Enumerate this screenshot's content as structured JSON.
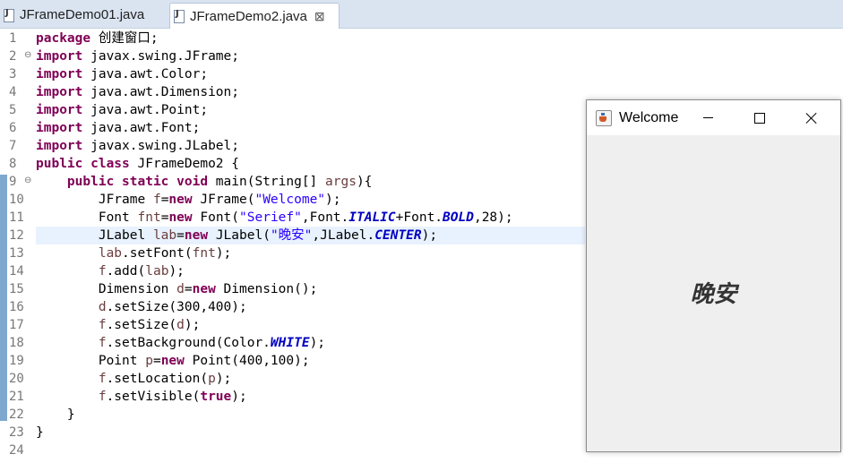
{
  "tabs": [
    {
      "label": "JFrameDemo01.java",
      "active": false
    },
    {
      "label": "JFrameDemo2.java",
      "active": true,
      "close": "⊠"
    }
  ],
  "editor": {
    "highlighted_line": 12,
    "lines": [
      {
        "n": "1",
        "fold": "",
        "tokens": [
          [
            "kw",
            "package"
          ],
          [
            "t",
            " 创建窗口;"
          ]
        ]
      },
      {
        "n": "2",
        "fold": "⊖",
        "tokens": [
          [
            "kw",
            "import"
          ],
          [
            "t",
            " javax.swing.JFrame;"
          ]
        ]
      },
      {
        "n": "3",
        "fold": "",
        "tokens": [
          [
            "kw",
            "import"
          ],
          [
            "t",
            " java.awt.Color;"
          ]
        ]
      },
      {
        "n": "4",
        "fold": "",
        "tokens": [
          [
            "kw",
            "import"
          ],
          [
            "t",
            " java.awt.Dimension;"
          ]
        ]
      },
      {
        "n": "5",
        "fold": "",
        "tokens": [
          [
            "kw",
            "import"
          ],
          [
            "t",
            " java.awt.Point;"
          ]
        ]
      },
      {
        "n": "6",
        "fold": "",
        "tokens": [
          [
            "kw",
            "import"
          ],
          [
            "t",
            " java.awt.Font;"
          ]
        ]
      },
      {
        "n": "7",
        "fold": "",
        "tokens": [
          [
            "kw",
            "import"
          ],
          [
            "t",
            " javax.swing.JLabel;"
          ]
        ]
      },
      {
        "n": "8",
        "fold": "",
        "tokens": [
          [
            "kw",
            "public class"
          ],
          [
            "t",
            " JFrameDemo2 {"
          ]
        ]
      },
      {
        "n": "9",
        "fold": "⊖",
        "tokens": [
          [
            "t",
            "    "
          ],
          [
            "kw",
            "public static void"
          ],
          [
            "t",
            " main(String[] "
          ],
          [
            "var",
            "args"
          ],
          [
            "t",
            "){"
          ]
        ]
      },
      {
        "n": "10",
        "fold": "",
        "tokens": [
          [
            "t",
            "        JFrame "
          ],
          [
            "var",
            "f"
          ],
          [
            "t",
            "="
          ],
          [
            "kw",
            "new"
          ],
          [
            "t",
            " JFrame("
          ],
          [
            "str",
            "\"Welcome\""
          ],
          [
            "t",
            ");"
          ]
        ]
      },
      {
        "n": "11",
        "fold": "",
        "tokens": [
          [
            "t",
            "        Font "
          ],
          [
            "var",
            "fnt"
          ],
          [
            "t",
            "="
          ],
          [
            "kw",
            "new"
          ],
          [
            "t",
            " Font("
          ],
          [
            "str",
            "\"Serief\""
          ],
          [
            "t",
            ",Font."
          ],
          [
            "cst",
            "ITALIC"
          ],
          [
            "t",
            "+Font."
          ],
          [
            "cst",
            "BOLD"
          ],
          [
            "t",
            ",28);"
          ]
        ]
      },
      {
        "n": "12",
        "fold": "",
        "tokens": [
          [
            "t",
            "        JLabel "
          ],
          [
            "var",
            "lab"
          ],
          [
            "t",
            "="
          ],
          [
            "kw",
            "new"
          ],
          [
            "t",
            " JLabel("
          ],
          [
            "str",
            "\"晚安\""
          ],
          [
            "t",
            ",JLabel."
          ],
          [
            "cst",
            "CENTER"
          ],
          [
            "t",
            ");"
          ]
        ]
      },
      {
        "n": "13",
        "fold": "",
        "tokens": [
          [
            "t",
            "        "
          ],
          [
            "var",
            "lab"
          ],
          [
            "t",
            ".setFont("
          ],
          [
            "var",
            "fnt"
          ],
          [
            "t",
            ");"
          ]
        ]
      },
      {
        "n": "14",
        "fold": "",
        "tokens": [
          [
            "t",
            "        "
          ],
          [
            "var",
            "f"
          ],
          [
            "t",
            ".add("
          ],
          [
            "var",
            "lab"
          ],
          [
            "t",
            ");"
          ]
        ]
      },
      {
        "n": "15",
        "fold": "",
        "tokens": [
          [
            "t",
            "        Dimension "
          ],
          [
            "var",
            "d"
          ],
          [
            "t",
            "="
          ],
          [
            "kw",
            "new"
          ],
          [
            "t",
            " Dimension();"
          ]
        ]
      },
      {
        "n": "16",
        "fold": "",
        "tokens": [
          [
            "t",
            "        "
          ],
          [
            "var",
            "d"
          ],
          [
            "t",
            ".setSize(300,400);"
          ]
        ]
      },
      {
        "n": "17",
        "fold": "",
        "tokens": [
          [
            "t",
            "        "
          ],
          [
            "var",
            "f"
          ],
          [
            "t",
            ".setSize("
          ],
          [
            "var",
            "d"
          ],
          [
            "t",
            ");"
          ]
        ]
      },
      {
        "n": "18",
        "fold": "",
        "tokens": [
          [
            "t",
            "        "
          ],
          [
            "var",
            "f"
          ],
          [
            "t",
            ".setBackground(Color."
          ],
          [
            "cst",
            "WHITE"
          ],
          [
            "t",
            ");"
          ]
        ]
      },
      {
        "n": "19",
        "fold": "",
        "tokens": [
          [
            "t",
            "        Point "
          ],
          [
            "var",
            "p"
          ],
          [
            "t",
            "="
          ],
          [
            "kw",
            "new"
          ],
          [
            "t",
            " Point(400,100);"
          ]
        ]
      },
      {
        "n": "20",
        "fold": "",
        "tokens": [
          [
            "t",
            "        "
          ],
          [
            "var",
            "f"
          ],
          [
            "t",
            ".setLocation("
          ],
          [
            "var",
            "p"
          ],
          [
            "t",
            ");"
          ]
        ]
      },
      {
        "n": "21",
        "fold": "",
        "tokens": [
          [
            "t",
            "        "
          ],
          [
            "var",
            "f"
          ],
          [
            "t",
            ".setVisible("
          ],
          [
            "kw",
            "true"
          ],
          [
            "t",
            ");"
          ]
        ]
      },
      {
        "n": "22",
        "fold": "",
        "tokens": [
          [
            "t",
            "    }"
          ]
        ]
      },
      {
        "n": "23",
        "fold": "",
        "tokens": [
          [
            "t",
            "}"
          ]
        ]
      },
      {
        "n": "24",
        "fold": "",
        "tokens": []
      }
    ]
  },
  "window": {
    "title": "Welcome",
    "label": "晚安",
    "icons": {
      "app": "java-cup-icon",
      "minimize": "minimize-icon",
      "maximize": "maximize-icon",
      "close": "close-icon"
    }
  },
  "colors": {
    "keyword": "#7f0055",
    "string": "#2a00ff",
    "constant": "#0000c0",
    "variable": "#6a3e3e",
    "highlight": "#e8f2fe"
  }
}
